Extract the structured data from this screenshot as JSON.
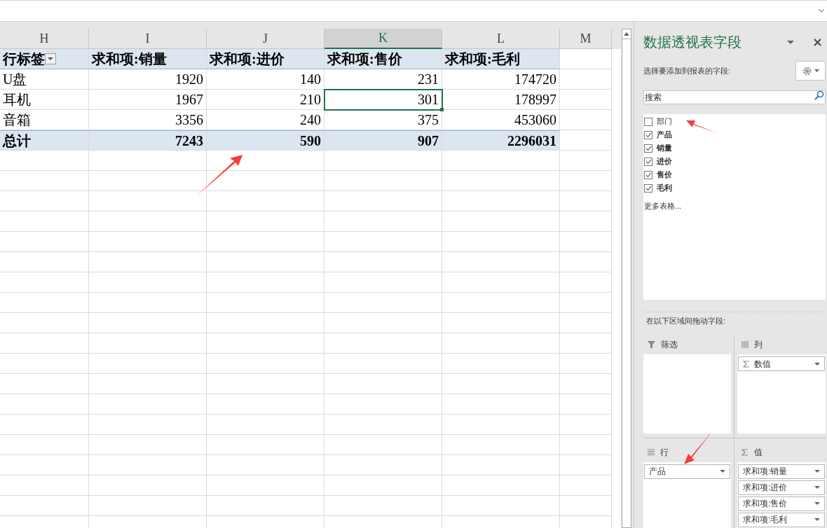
{
  "sheet": {
    "columns": [
      {
        "label": "H",
        "selected": false
      },
      {
        "label": "I",
        "selected": false
      },
      {
        "label": "J",
        "selected": false
      },
      {
        "label": "K",
        "selected": true
      },
      {
        "label": "L",
        "selected": false
      },
      {
        "label": "M",
        "selected": false
      }
    ],
    "pivot_header": [
      "行标签",
      "求和项:销量",
      "求和项:进价",
      "求和项:售价",
      "求和项:毛利"
    ],
    "rows": [
      {
        "cells": [
          "U盘",
          "1920",
          "140",
          "231",
          "174720"
        ],
        "selected": false
      },
      {
        "cells": [
          "耳机",
          "1967",
          "210",
          "301",
          "178997"
        ],
        "selected": true
      },
      {
        "cells": [
          "音箱",
          "3356",
          "240",
          "375",
          "453060"
        ],
        "selected": false
      }
    ],
    "total": [
      "总计",
      "7243",
      "590",
      "907",
      "2296031"
    ]
  },
  "panel": {
    "title": "数据透视表字段",
    "subtitle": "选择要添加到报表的字段:",
    "search": {
      "placeholder": "搜索"
    },
    "fields": [
      {
        "label": "部门",
        "checked": false
      },
      {
        "label": "产品",
        "checked": true
      },
      {
        "label": "销量",
        "checked": true
      },
      {
        "label": "进价",
        "checked": true
      },
      {
        "label": "售价",
        "checked": true
      },
      {
        "label": "毛利",
        "checked": true
      }
    ],
    "more_tables": "更多表格...",
    "drag_hint": "在以下区域间拖动字段:",
    "areas": [
      {
        "kind": "filter",
        "label": "筛选"
      },
      {
        "kind": "columns",
        "label": "列",
        "items": [
          "数值"
        ]
      },
      {
        "kind": "rows",
        "label": "行",
        "items": [
          "产品"
        ]
      },
      {
        "kind": "values",
        "label": "值",
        "items": [
          "求和项:销量",
          "求和项:进价",
          "求和项:售价",
          "求和项:毛利"
        ]
      }
    ]
  }
}
